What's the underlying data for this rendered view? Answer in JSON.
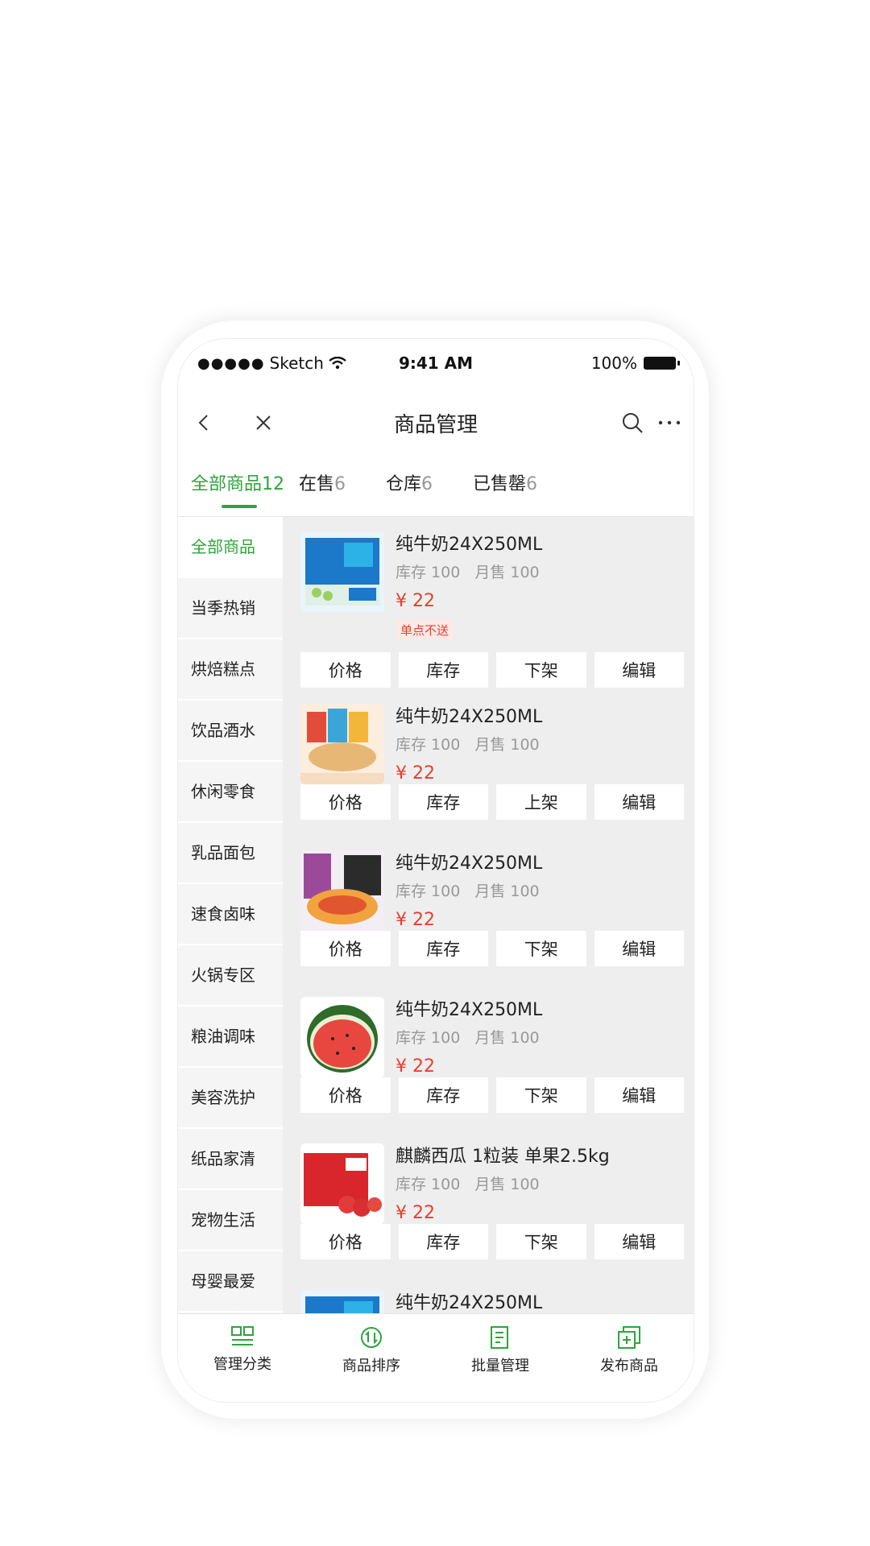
{
  "status_bar": {
    "signal": "●●●●●",
    "carrier": "Sketch",
    "time": "9:41 AM",
    "battery": "100%"
  },
  "nav": {
    "title": "商品管理",
    "back_icon": "chevron-left-icon",
    "close_icon": "close-icon",
    "search_icon": "search-icon",
    "more_icon": "more-icon"
  },
  "tabs": [
    {
      "label": "全部商品",
      "count": "12",
      "active": true
    },
    {
      "label": "在售",
      "count": "6"
    },
    {
      "label": "仓库",
      "count": "6"
    },
    {
      "label": "已售罄",
      "count": "6"
    }
  ],
  "categories": [
    {
      "label": "全部商品",
      "active": true
    },
    {
      "label": "当季热销"
    },
    {
      "label": "烘焙糕点"
    },
    {
      "label": "饮品酒水"
    },
    {
      "label": "休闲零食"
    },
    {
      "label": "乳品面包"
    },
    {
      "label": "速食卤味"
    },
    {
      "label": "火锅专区"
    },
    {
      "label": "粮油调味"
    },
    {
      "label": "美容洗护"
    },
    {
      "label": "纸品家清"
    },
    {
      "label": "宠物生活"
    },
    {
      "label": "母婴最爱"
    }
  ],
  "stock_label": "库存 100",
  "sales_label": "月售 100",
  "products": [
    {
      "name": "纯牛奶24X250ML",
      "price": "¥ 22",
      "tag": "单点不送",
      "thumb": "milk-box-image",
      "actions": [
        "价格",
        "库存",
        "下架",
        "编辑"
      ]
    },
    {
      "name": "纯牛奶24X250ML",
      "price": "¥ 22",
      "thumb": "snack-box-image",
      "actions": [
        "价格",
        "库存",
        "上架",
        "编辑"
      ]
    },
    {
      "name": "纯牛奶24X250ML",
      "price": "¥ 22",
      "thumb": "noodle-bag-image",
      "actions": [
        "价格",
        "库存",
        "下架",
        "编辑"
      ]
    },
    {
      "name": "纯牛奶24X250ML",
      "price": "¥ 22",
      "thumb": "watermelon-image",
      "actions": [
        "价格",
        "库存",
        "下架",
        "编辑"
      ]
    },
    {
      "name": "麒麟西瓜 1粒装 单果2.5kg",
      "price": "¥ 22",
      "thumb": "apple-gift-box-image",
      "actions": [
        "价格",
        "库存",
        "下架",
        "编辑"
      ]
    },
    {
      "name": "纯牛奶24X250ML",
      "thumb": "milk-box-image"
    }
  ],
  "bottom_bar": [
    {
      "label": "管理分类",
      "icon": "category-icon"
    },
    {
      "label": "商品排序",
      "icon": "sort-icon"
    },
    {
      "label": "批量管理",
      "icon": "batch-edit-icon"
    },
    {
      "label": "发布商品",
      "icon": "add-product-icon"
    }
  ],
  "colors": {
    "accent": "#2ea53c",
    "price": "#e4412f",
    "muted": "#999999",
    "list_bg": "#eeeeee",
    "sidebar_bg": "#f5f5f5"
  }
}
